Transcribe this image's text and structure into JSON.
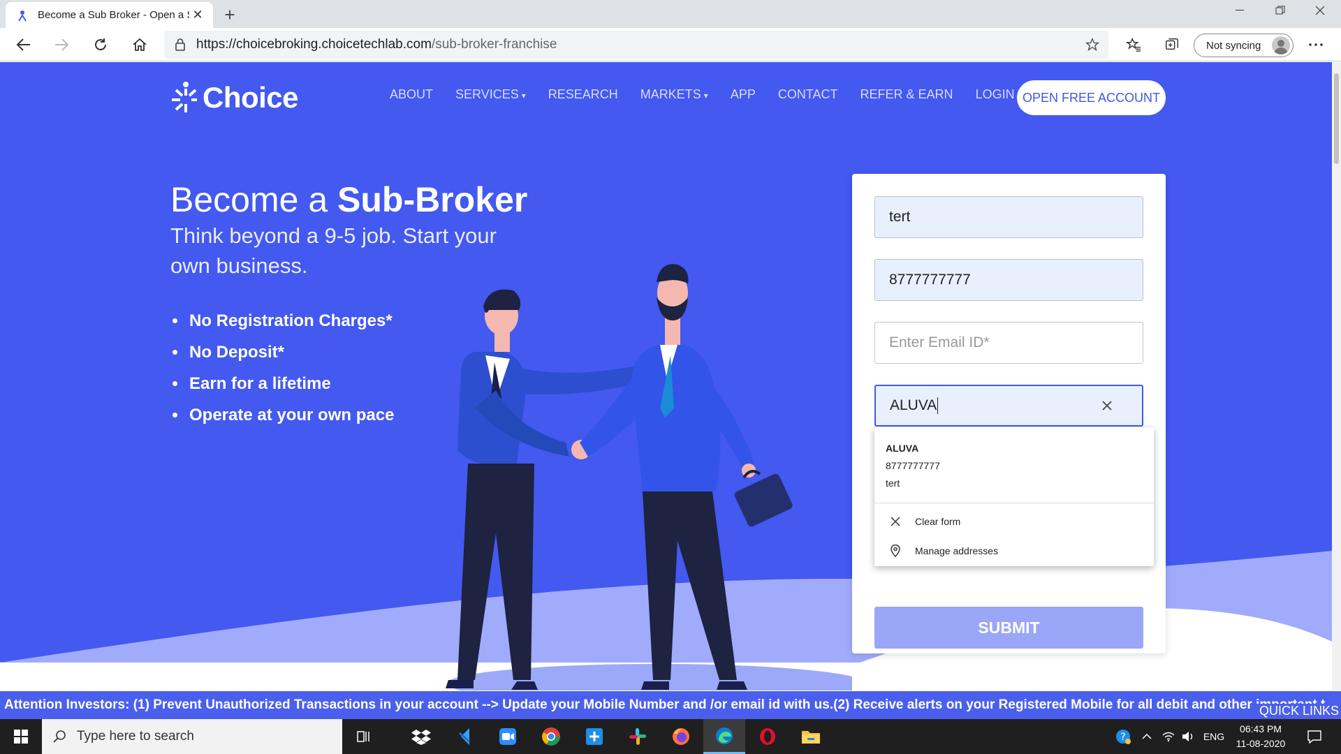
{
  "browser": {
    "tab_title": "Become a Sub Broker - Open a Sub",
    "url_domain": "https://choicebroking.choicetechlab.com",
    "url_path": "/sub-broker-franchise",
    "sync_label": "Not syncing"
  },
  "site": {
    "logo_text": "Choice",
    "nav": {
      "about": "ABOUT",
      "services": "SERVICES",
      "research": "RESEARCH",
      "markets": "MARKETS",
      "app": "APP",
      "contact": "CONTACT",
      "refer": "REFER & EARN",
      "login": "LOGIN",
      "caret": "▾"
    },
    "open_account": "OPEN FREE ACCOUNT"
  },
  "hero": {
    "title_light": "Become a ",
    "title_bold": "Sub-Broker",
    "subtitle": "Think beyond a 9-5 job. Start your own business.",
    "bullets": [
      "No Registration Charges*",
      "No Deposit*",
      "Earn for a lifetime",
      "Operate at your own pace"
    ]
  },
  "form": {
    "name_value": "tert",
    "mobile_value": "8777777777",
    "email_placeholder": "Enter Email ID*",
    "city_value": "ALUVA",
    "submit_label": "SUBMIT"
  },
  "autofill": {
    "suggestion_main": "ALUVA",
    "suggestion_line2": "8777777777",
    "suggestion_line3": "tert",
    "clear_label": "Clear form",
    "manage_label": "Manage addresses"
  },
  "ticker": {
    "text": "Attention Investors: (1) Prevent Unauthorized Transactions in your account --> Update your Mobile Number and /or email id with us.(2) Receive alerts on your Registered Mobile for all debit and other important t",
    "quick_links": "QUICK LINKS"
  },
  "taskbar": {
    "search_placeholder": "Type here to search",
    "language": "ENG",
    "time": "06:43 PM",
    "date": "11-08-2020"
  },
  "colors": {
    "brand_blue": "#4359f0",
    "submit_disabled": "#9aa6f7",
    "autofill_bg": "#e8f0fe"
  }
}
